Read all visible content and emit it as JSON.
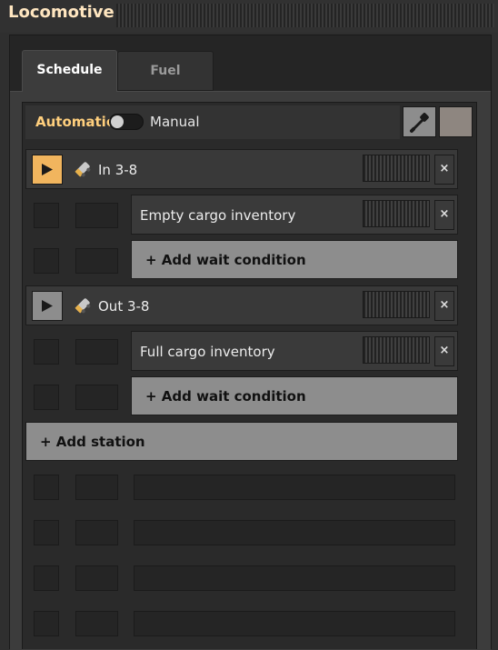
{
  "window": {
    "title": "Locomotive"
  },
  "tabs": [
    {
      "label": "Schedule"
    },
    {
      "label": "Fuel"
    }
  ],
  "mode": {
    "automatic_label": "Automatic",
    "manual_label": "Manual",
    "colors": {
      "automatic": "#ffcf7d",
      "active_play": "#f1b55e"
    }
  },
  "icons": {
    "eyedropper": "eyedropper-icon",
    "train": "locomotive-icon",
    "play": "play-icon",
    "close": "close-icon"
  },
  "schedule": {
    "stations": [
      {
        "name": "In 3-8",
        "active": true,
        "conditions": [
          {
            "label": "Empty cargo inventory"
          }
        ],
        "add_condition_label": "+ Add wait condition"
      },
      {
        "name": "Out 3-8",
        "active": false,
        "conditions": [
          {
            "label": "Full cargo inventory"
          }
        ],
        "add_condition_label": "+ Add wait condition"
      }
    ],
    "add_station_label": "+ Add station",
    "close_glyph": "×"
  }
}
